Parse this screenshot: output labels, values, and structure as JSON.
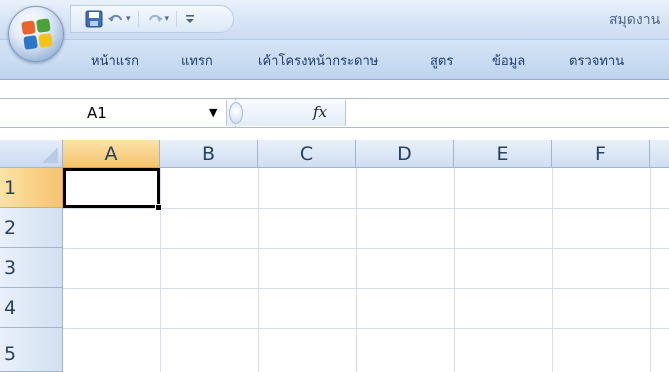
{
  "app": {
    "title_partial": "สมุดงาน",
    "office_button": "office-button",
    "quick_access": {
      "save_icon": "save-icon",
      "undo_icon": "undo-icon",
      "redo_icon": "redo-icon",
      "customize_icon": "customize-dropdown-icon"
    }
  },
  "ribbon": {
    "tabs": [
      "หน้าแรก",
      "แทรก",
      "เค้าโครงหน้ากระดาษ",
      "สูตร",
      "ข้อมูล",
      "ตรวจทาน"
    ]
  },
  "formula_bar": {
    "name_box": "A1",
    "fx_label": "fx",
    "formula_value": ""
  },
  "sheet": {
    "columns": [
      "A",
      "B",
      "C",
      "D",
      "E",
      "F"
    ],
    "rows": [
      "1",
      "2",
      "3",
      "4",
      "5"
    ],
    "active_cell": "A1",
    "active_column": "A",
    "active_row": "1",
    "colors": {
      "header_blue": "#cfdef2",
      "active_header": "#f5c36d",
      "gridline": "#d6dee8"
    }
  }
}
